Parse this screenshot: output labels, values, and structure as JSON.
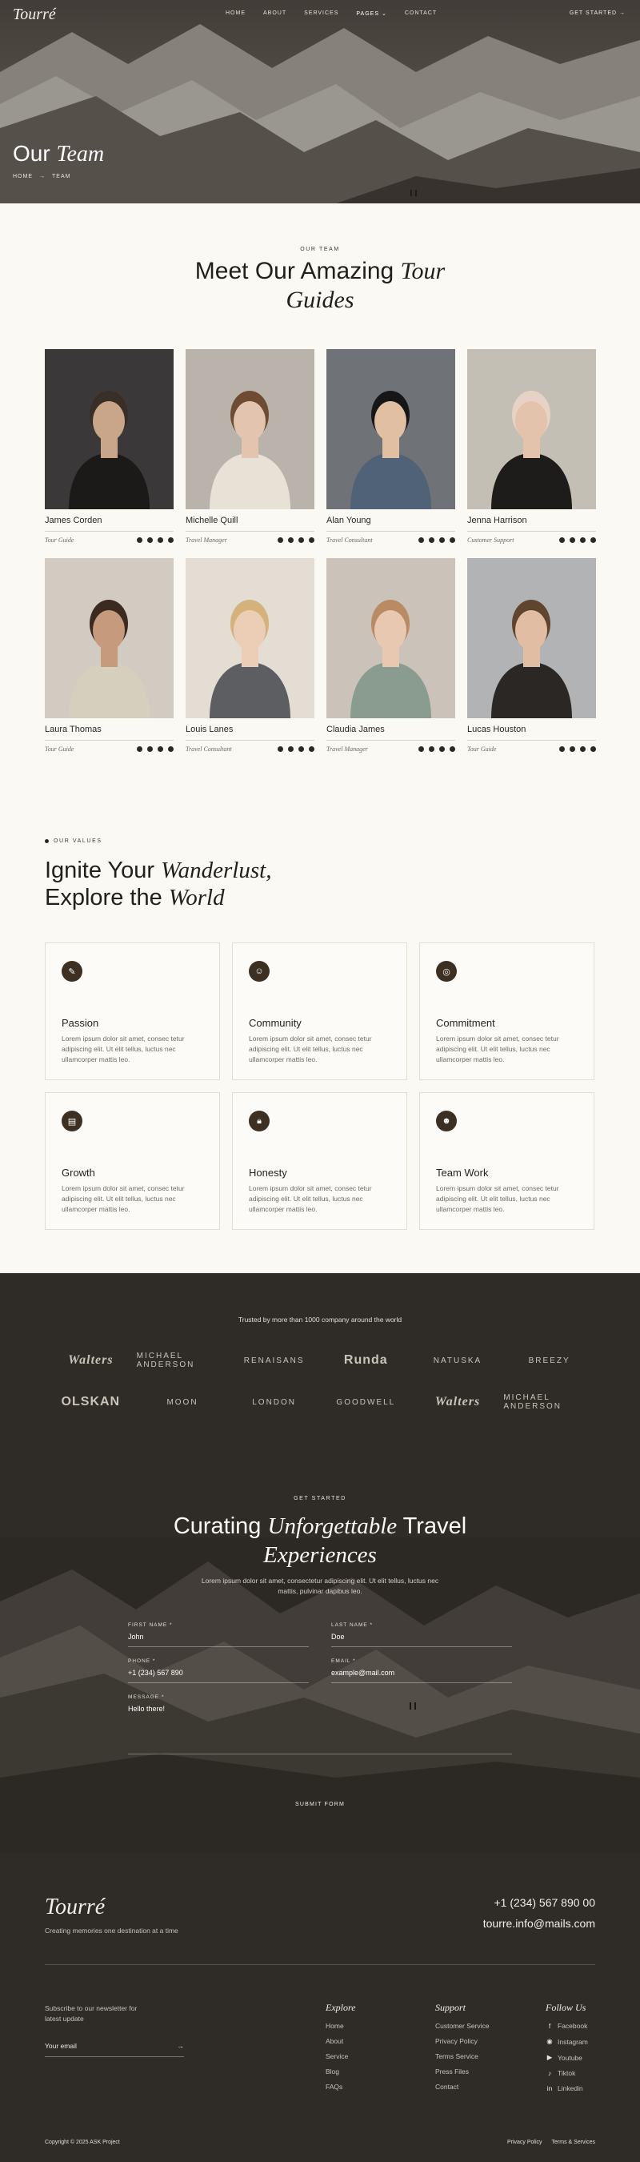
{
  "brand": {
    "logo": "Tourré"
  },
  "nav": {
    "links": [
      "HOME",
      "ABOUT",
      "SERVICES",
      "PAGES ⌄",
      "CONTACT"
    ],
    "cta": "GET STARTED →"
  },
  "hero": {
    "title_plain": "Our",
    "title_italic": "Team",
    "breadcrumb": [
      "HOME",
      "→",
      "TEAM"
    ]
  },
  "team": {
    "eyebrow": "OUR TEAM",
    "title_plain": "Meet Our Amazing",
    "title_italic_1": "Tour",
    "title_italic_2": "Guides",
    "members": [
      {
        "name": "James Corden",
        "role": "Tour Guide",
        "bg": "#3a3838",
        "skin": "#c9a58a",
        "hair": "#3a2f28",
        "clothes": "#1c1a19"
      },
      {
        "name": "Michelle Quill",
        "role": "Travel Manager",
        "bg": "#b9b3ab",
        "skin": "#e3c4ae",
        "hair": "#6e4c33",
        "clothes": "#e8e1d6"
      },
      {
        "name": "Alan Young",
        "role": "Travel Consultant",
        "bg": "#6f7276",
        "skin": "#e0bfa2",
        "hair": "#171616",
        "clothes": "#4f6277"
      },
      {
        "name": "Jenna Harrison",
        "role": "Customer Support",
        "bg": "#c4bfb5",
        "skin": "#e4c3ad",
        "hair": "#e6d3c6",
        "clothes": "#1d1c1b"
      },
      {
        "name": "Laura Thomas",
        "role": "Tour Guide",
        "bg": "#d2cbc1",
        "skin": "#c69a7c",
        "hair": "#3b2a20",
        "clothes": "#d6cfbd"
      },
      {
        "name": "Louis Lanes",
        "role": "Travel Consultant",
        "bg": "#e3ddd3",
        "skin": "#eccdb5",
        "hair": "#d3b27c",
        "clothes": "#5d5e62"
      },
      {
        "name": "Claudia James",
        "role": "Travel Manager",
        "bg": "#cbc3ba",
        "skin": "#e9c8b1",
        "hair": "#b98a64",
        "clothes": "#8a9b90"
      },
      {
        "name": "Lucas Houston",
        "role": "Tour Guide",
        "bg": "#b2b3b4",
        "skin": "#e1bea3",
        "hair": "#5f442e",
        "clothes": "#2a2724"
      }
    ]
  },
  "values": {
    "eyebrow": "OUR VALUES",
    "line1_plain": "Ignite Your",
    "line1_italic": "Wanderlust,",
    "line2_plain": "Explore the",
    "line2_italic": "World",
    "items": [
      {
        "name": "Passion",
        "icon": "pencil-icon",
        "glyph": "✎",
        "text": "Lorem ipsum dolor sit amet, consec tetur adipiscing elit. Ut elit tellus, luctus nec ullamcorper mattis leo."
      },
      {
        "name": "Community",
        "icon": "people-icon",
        "glyph": "☺",
        "text": "Lorem ipsum dolor sit amet, consec tetur adipiscing elit. Ut elit tellus, luctus nec ullamcorper mattis leo."
      },
      {
        "name": "Commitment",
        "icon": "target-icon",
        "glyph": "◎",
        "text": "Lorem ipsum dolor sit amet, consec tetur adipiscing elit. Ut elit tellus, luctus nec ullamcorper mattis leo."
      },
      {
        "name": "Growth",
        "icon": "chart-icon",
        "glyph": "▤",
        "text": "Lorem ipsum dolor sit amet, consec tetur adipiscing elit. Ut elit tellus, luctus nec ullamcorper mattis leo."
      },
      {
        "name": "Honesty",
        "icon": "lock-icon",
        "glyph": "🔒︎",
        "text": "Lorem ipsum dolor sit amet, consec tetur adipiscing elit. Ut elit tellus, luctus nec ullamcorper mattis leo."
      },
      {
        "name": "Team Work",
        "icon": "user-icon",
        "glyph": "☻",
        "text": "Lorem ipsum dolor sit amet, consec tetur adipiscing elit. Ut elit tellus, luctus nec ullamcorper mattis leo."
      }
    ]
  },
  "trusted": {
    "text": "Trusted by more than 1000 company around the world",
    "logos": [
      "Walters",
      "MICHAEL ANDERSON",
      "RENAISANS",
      "Runda",
      "NATUSKA",
      "BREEZY",
      "OLSKAN",
      "MOON",
      "LONDON",
      "GOODWELL",
      "Walters",
      "MICHAEL ANDERSON"
    ]
  },
  "get_started": {
    "eyebrow": "GET STARTED",
    "title_italic_1": "Unforgettable",
    "title_plain_1": "Curating",
    "title_plain_2": "Travel",
    "title_italic_2": "Experiences",
    "desc": "Lorem ipsum dolor sit amet, consectetur adipiscing elit. Ut elit tellus, luctus nec mattis, pulvinar dapibus leo.",
    "fields": {
      "first_name_label": "FIRST NAME *",
      "first_name_value": "John",
      "last_name_label": "LAST NAME *",
      "last_name_value": "Doe",
      "phone_label": "PHONE *",
      "phone_value": "+1 (234) 567 890",
      "email_label": "EMAIL *",
      "email_value": "example@mail.com",
      "message_label": "MESSAGE *",
      "message_value": "Hello there!"
    },
    "submit": "SUBMIT FORM"
  },
  "footer": {
    "logo": "Tourré",
    "tagline": "Creating memories one destination at a time",
    "phone": "+1 (234) 567 890 00",
    "email": "tourre.info@mails.com",
    "newsletter": "Subscribe to our newsletter for latest update",
    "email_placeholder": "Your email",
    "arrow": "→",
    "explore_title": "Explore",
    "explore": [
      "Home",
      "About",
      "Service",
      "Blog",
      "FAQs"
    ],
    "support_title": "Support",
    "support": [
      "Customer Service",
      "Privacy Policy",
      "Terms Service",
      "Press Files",
      "Contact"
    ],
    "follow_title": "Follow Us",
    "follow": [
      {
        "label": "Facebook",
        "glyph": "f"
      },
      {
        "label": "Instagram",
        "glyph": "◉"
      },
      {
        "label": "Youtube",
        "glyph": "▶"
      },
      {
        "label": "Tiktok",
        "glyph": "♪"
      },
      {
        "label": "Linkedin",
        "glyph": "in"
      }
    ],
    "copyright": "Copyright © 2025 ASK Project",
    "privacy": "Privacy Policy",
    "terms": "Terms & Services"
  }
}
